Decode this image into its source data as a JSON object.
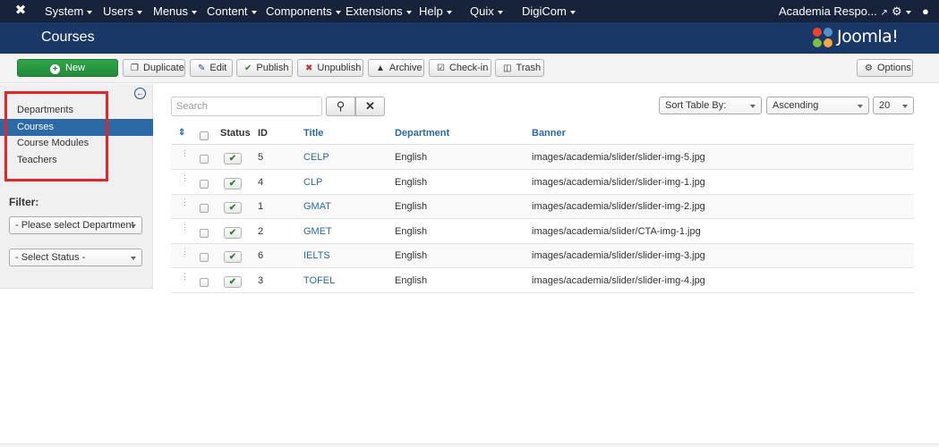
{
  "navbar": {
    "logo_icon": "joomla-icon",
    "menus": [
      "System",
      "Users",
      "Menus",
      "Content",
      "Components",
      "Extensions",
      "Help",
      "Quix",
      "DigiCom"
    ],
    "site_name": "Academia Respo...",
    "external_icon": "external-link-icon",
    "settings_icon": "gear-icon",
    "user_icon": "user-icon"
  },
  "header": {
    "title": "Courses",
    "brand": "Joomla!"
  },
  "toolbar": {
    "new": "New",
    "duplicate": "Duplicate",
    "edit": "Edit",
    "publish": "Publish",
    "unpublish": "Unpublish",
    "archive": "Archive",
    "checkin": "Check-in",
    "trash": "Trash",
    "options": "Options"
  },
  "sidebar": {
    "items": [
      {
        "label": "Departments",
        "active": false
      },
      {
        "label": "Courses",
        "active": true
      },
      {
        "label": "Course Modules",
        "active": false
      },
      {
        "label": "Teachers",
        "active": false
      }
    ],
    "filter_label": "Filter:",
    "department_select": "- Please select Department",
    "status_select": "- Select Status -"
  },
  "search": {
    "placeholder": "Search"
  },
  "list_controls": {
    "sort_by": "Sort Table By:",
    "direction": "Ascending",
    "limit": "20"
  },
  "table": {
    "headers": {
      "status": "Status",
      "id": "ID",
      "title": "Title",
      "department": "Department",
      "banner": "Banner"
    },
    "rows": [
      {
        "id": "5",
        "title": "CELP",
        "department": "English",
        "banner": "images/academia/slider/slider-img-5.jpg"
      },
      {
        "id": "4",
        "title": "CLP",
        "department": "English",
        "banner": "images/academia/slider/slider-img-1.jpg"
      },
      {
        "id": "1",
        "title": "GMAT",
        "department": "English",
        "banner": "images/academia/slider/slider-img-2.jpg"
      },
      {
        "id": "2",
        "title": "GMET",
        "department": "English",
        "banner": "images/academia/slider/CTA-img-1.jpg"
      },
      {
        "id": "6",
        "title": "IELTS",
        "department": "English",
        "banner": "images/academia/slider/slider-img-3.jpg"
      },
      {
        "id": "3",
        "title": "TOFEL",
        "department": "English",
        "banner": "images/academia/slider/slider-img-4.jpg"
      }
    ]
  },
  "colors": {
    "navbar": "#17233a",
    "header": "#1a3867",
    "accent": "#2b6aa6",
    "new_button": "#2fa54a",
    "highlight": "#e4262b"
  }
}
